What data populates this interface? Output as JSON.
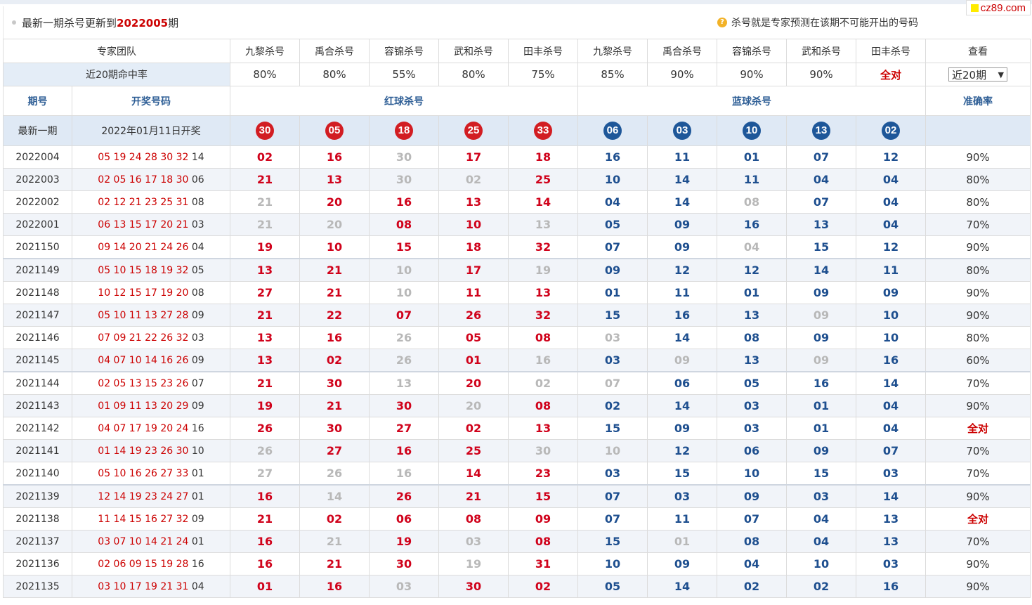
{
  "brand": {
    "text": "cz89.com"
  },
  "header": {
    "title_prefix": "最新一期杀号更新到",
    "title_issue": "2022005",
    "title_suffix": "期",
    "tip_icon": "question-icon",
    "tip": "杀号就是专家预测在该期不可能开出的号码"
  },
  "team_row": {
    "label": "专家团队",
    "experts": [
      "九黎杀号",
      "禹合杀号",
      "容锦杀号",
      "武和杀号",
      "田丰杀号",
      "九黎杀号",
      "禹合杀号",
      "容锦杀号",
      "武和杀号",
      "田丰杀号"
    ],
    "view": "查看"
  },
  "rate_row": {
    "label": "近20期命中率",
    "rates": [
      "80%",
      "80%",
      "55%",
      "80%",
      "75%",
      "85%",
      "90%",
      "90%",
      "90%",
      "全对"
    ],
    "select_value": "近20期"
  },
  "col_head": {
    "issue": "期号",
    "draw": "开奖号码",
    "red": "红球杀号",
    "blue": "蓝球杀号",
    "accuracy": "准确率"
  },
  "latest": {
    "label": "最新一期",
    "date": "2022年01月11日开奖",
    "red_kills": [
      "30",
      "05",
      "18",
      "25",
      "33"
    ],
    "blue_kills": [
      "06",
      "03",
      "10",
      "13",
      "02"
    ]
  },
  "rows": [
    {
      "issue": "2022004",
      "red": "05 19 24 28 30 32",
      "blue": "14",
      "kills": [
        "02",
        "16",
        "30",
        "17",
        "18",
        "16",
        "11",
        "01",
        "07",
        "12"
      ],
      "miss": [
        2
      ],
      "acc": "90%"
    },
    {
      "issue": "2022003",
      "red": "02 05 16 17 18 30",
      "blue": "06",
      "kills": [
        "21",
        "13",
        "30",
        "02",
        "25",
        "10",
        "14",
        "11",
        "04",
        "04"
      ],
      "miss": [
        2,
        3
      ],
      "acc": "80%"
    },
    {
      "issue": "2022002",
      "red": "02 12 21 23 25 31",
      "blue": "08",
      "kills": [
        "21",
        "20",
        "16",
        "13",
        "14",
        "04",
        "14",
        "08",
        "07",
        "04"
      ],
      "miss": [
        0,
        7
      ],
      "acc": "80%"
    },
    {
      "issue": "2022001",
      "red": "06 13 15 17 20 21",
      "blue": "03",
      "kills": [
        "21",
        "20",
        "08",
        "10",
        "13",
        "05",
        "09",
        "16",
        "13",
        "04"
      ],
      "miss": [
        0,
        1,
        4
      ],
      "acc": "70%"
    },
    {
      "issue": "2021150",
      "red": "09 14 20 21 24 26",
      "blue": "04",
      "kills": [
        "19",
        "10",
        "15",
        "18",
        "32",
        "07",
        "09",
        "04",
        "15",
        "12"
      ],
      "miss": [
        7
      ],
      "acc": "90%"
    },
    {
      "issue": "2021149",
      "red": "05 10 15 18 19 32",
      "blue": "05",
      "kills": [
        "13",
        "21",
        "10",
        "17",
        "19",
        "09",
        "12",
        "12",
        "14",
        "11"
      ],
      "miss": [
        2,
        4
      ],
      "acc": "80%"
    },
    {
      "issue": "2021148",
      "red": "10 12 15 17 19 20",
      "blue": "08",
      "kills": [
        "27",
        "21",
        "10",
        "11",
        "13",
        "01",
        "11",
        "01",
        "09",
        "09"
      ],
      "miss": [
        2
      ],
      "acc": "90%"
    },
    {
      "issue": "2021147",
      "red": "05 10 11 13 27 28",
      "blue": "09",
      "kills": [
        "21",
        "22",
        "07",
        "26",
        "32",
        "15",
        "16",
        "13",
        "09",
        "10"
      ],
      "miss": [
        8
      ],
      "acc": "90%"
    },
    {
      "issue": "2021146",
      "red": "07 09 21 22 26 32",
      "blue": "03",
      "kills": [
        "13",
        "16",
        "26",
        "05",
        "08",
        "03",
        "14",
        "08",
        "09",
        "10"
      ],
      "miss": [
        2,
        5
      ],
      "acc": "80%"
    },
    {
      "issue": "2021145",
      "red": "04 07 10 14 16 26",
      "blue": "09",
      "kills": [
        "13",
        "02",
        "26",
        "01",
        "16",
        "03",
        "09",
        "13",
        "09",
        "16"
      ],
      "miss": [
        2,
        4,
        6,
        8
      ],
      "acc": "60%"
    },
    {
      "issue": "2021144",
      "red": "02 05 13 15 23 26",
      "blue": "07",
      "kills": [
        "21",
        "30",
        "13",
        "20",
        "02",
        "07",
        "06",
        "05",
        "16",
        "14"
      ],
      "miss": [
        2,
        4,
        5
      ],
      "acc": "70%"
    },
    {
      "issue": "2021143",
      "red": "01 09 11 13 20 29",
      "blue": "09",
      "kills": [
        "19",
        "21",
        "30",
        "20",
        "08",
        "02",
        "14",
        "03",
        "01",
        "04"
      ],
      "miss": [
        3
      ],
      "acc": "90%"
    },
    {
      "issue": "2021142",
      "red": "04 07 17 19 20 24",
      "blue": "16",
      "kills": [
        "26",
        "30",
        "27",
        "02",
        "13",
        "15",
        "09",
        "03",
        "01",
        "04"
      ],
      "miss": [],
      "acc": "全对"
    },
    {
      "issue": "2021141",
      "red": "01 14 19 23 26 30",
      "blue": "10",
      "kills": [
        "26",
        "27",
        "16",
        "25",
        "30",
        "10",
        "12",
        "06",
        "09",
        "07"
      ],
      "miss": [
        0,
        4,
        5
      ],
      "acc": "70%"
    },
    {
      "issue": "2021140",
      "red": "05 10 16 26 27 33",
      "blue": "01",
      "kills": [
        "27",
        "26",
        "16",
        "14",
        "23",
        "03",
        "15",
        "10",
        "15",
        "03"
      ],
      "miss": [
        0,
        1,
        2
      ],
      "acc": "70%"
    },
    {
      "issue": "2021139",
      "red": "12 14 19 23 24 27",
      "blue": "01",
      "kills": [
        "16",
        "14",
        "26",
        "21",
        "15",
        "07",
        "03",
        "09",
        "03",
        "14"
      ],
      "miss": [
        1
      ],
      "acc": "90%"
    },
    {
      "issue": "2021138",
      "red": "11 14 15 16 27 32",
      "blue": "09",
      "kills": [
        "21",
        "02",
        "06",
        "08",
        "09",
        "07",
        "11",
        "07",
        "04",
        "13"
      ],
      "miss": [],
      "acc": "全对"
    },
    {
      "issue": "2021137",
      "red": "03 07 10 14 21 24",
      "blue": "01",
      "kills": [
        "16",
        "21",
        "19",
        "03",
        "08",
        "15",
        "01",
        "08",
        "04",
        "13"
      ],
      "miss": [
        1,
        3,
        6
      ],
      "acc": "70%"
    },
    {
      "issue": "2021136",
      "red": "02 06 09 15 19 28",
      "blue": "16",
      "kills": [
        "16",
        "21",
        "30",
        "19",
        "31",
        "10",
        "09",
        "04",
        "10",
        "03"
      ],
      "miss": [
        3
      ],
      "acc": "90%"
    },
    {
      "issue": "2021135",
      "red": "03 10 17 19 21 31",
      "blue": "04",
      "kills": [
        "01",
        "16",
        "03",
        "30",
        "02",
        "05",
        "14",
        "02",
        "02",
        "16"
      ],
      "miss": [
        2
      ],
      "acc": "90%"
    }
  ]
}
